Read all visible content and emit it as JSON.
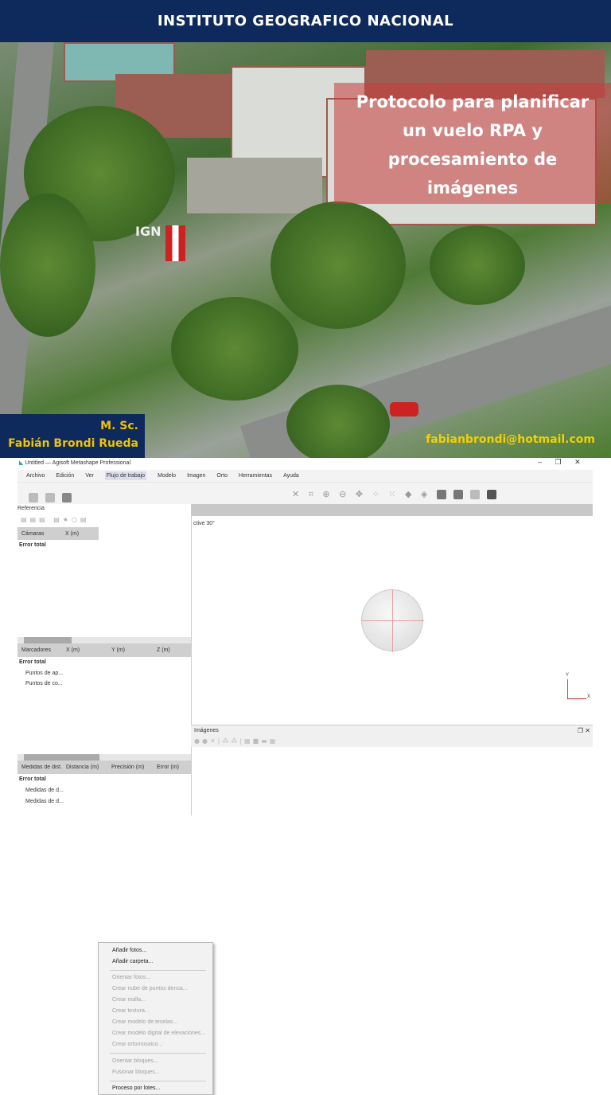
{
  "slide": {
    "header": "INSTITUTO GEOGRAFICO NACIONAL",
    "title_lines": [
      "Protocolo para planificar",
      "un vuelo RPA y",
      "procesamiento de",
      "imágenes"
    ],
    "author_lines": [
      "M. Sc.",
      "Fabián Brondi Rueda"
    ],
    "email": "fabianbrondi@hotmail.com",
    "photo_sign": "IGN"
  },
  "app": {
    "window_title": "Untitled — Agisoft Metashape Professional",
    "menu": [
      "Archivo",
      "Edición",
      "Ver",
      "Flujo de trabajo",
      "Modelo",
      "Imagen",
      "Orto",
      "Herramientas",
      "Ayuda"
    ],
    "workflow_menu": [
      {
        "label": "Añadir fotos...",
        "enabled": true
      },
      {
        "label": "Añadir carpeta...",
        "enabled": true
      },
      {
        "label": "Orientar fotos...",
        "enabled": false
      },
      {
        "label": "Crear nube de puntos densa...",
        "enabled": false
      },
      {
        "label": "Crear malla...",
        "enabled": false
      },
      {
        "label": "Crear textura...",
        "enabled": false
      },
      {
        "label": "Crear modelo de teselas...",
        "enabled": false
      },
      {
        "label": "Crear modelo digital de elevaciones...",
        "enabled": false
      },
      {
        "label": "Crear ortomosaico...",
        "enabled": false
      },
      {
        "label": "Orientar bloques...",
        "enabled": false
      },
      {
        "label": "Fusionar bloques...",
        "enabled": false
      },
      {
        "label": "Proceso por lotes...",
        "enabled": true
      }
    ],
    "reference_panel": "Referencia",
    "cameras_table": {
      "headers": [
        "Cámaras",
        "X (m)"
      ],
      "rows": [
        "Error total"
      ]
    },
    "markers_table": {
      "headers": [
        "Marcadores",
        "X (m)",
        "Y (m)",
        "Z (m)"
      ],
      "rows": [
        "Error total",
        "Puntos de ap...",
        "Puntos de co..."
      ]
    },
    "scalebars_table": {
      "headers": [
        "Medidas de dist.",
        "Distancia (m)",
        "Precisión (m)",
        "Error (m)"
      ],
      "rows": [
        "Error total",
        "Medidas de d...",
        "Medidas de d..."
      ]
    },
    "viewport_label": "ctive 30°",
    "axis_labels": [
      "Y",
      "X"
    ],
    "photos_panel": "Imágenes"
  }
}
